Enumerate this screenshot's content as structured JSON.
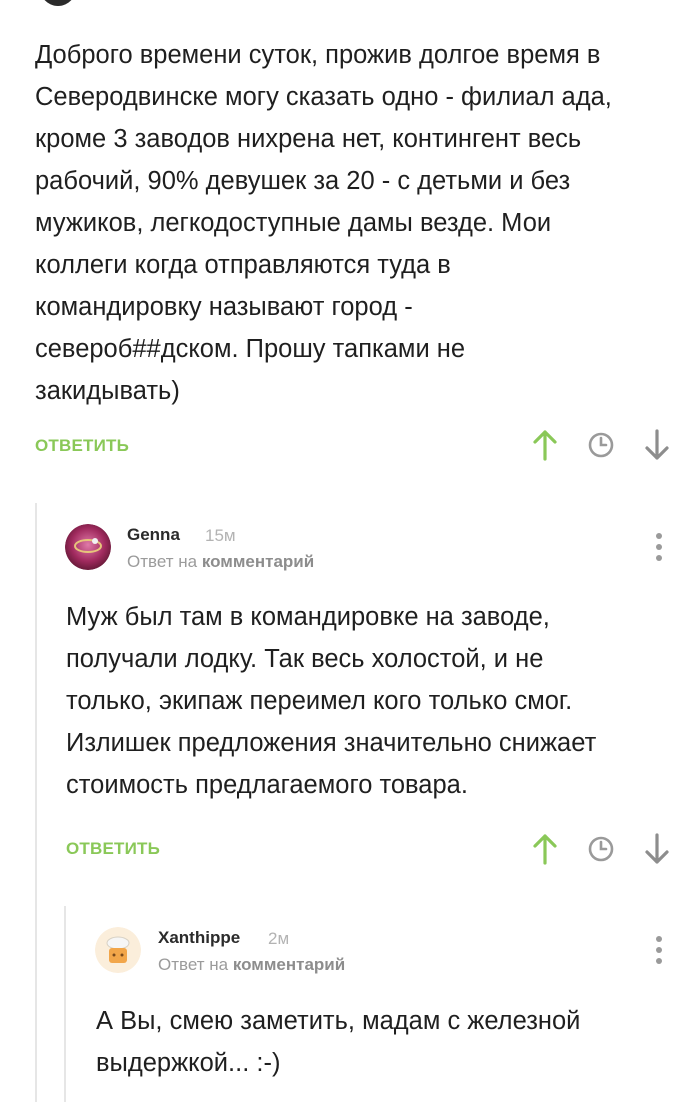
{
  "comment_root": {
    "text": "Доброго времени суток, прожив долгое время в\nСеверодвинске могу сказать одно - филиал ада,\nкроме 3 заводов нихрена нет, контингент весь\nрабочий, 90% девушек за 20 - с детьми и без\nмужиков, легкодоступные дамы везде. Мои\nколлеги когда  отправляются туда в\nкомандировку называют город -\nсевероб##дском. Прошу тапками не\nзакидывать)",
    "reply_label": "ОТВЕТИТЬ"
  },
  "comment_genna": {
    "author": "Genna",
    "time": "15м",
    "reply_prefix": "Ответ на",
    "reply_target": "комментарий",
    "text": "Муж был там в командировке на заводе,\nполучали лодку. Так весь холостой, и не\nтолько, экипаж переимел кого только смог.\nИзлишек предложения значительно снижает\nстоимость предлагаемого товара.",
    "reply_label": "ОТВЕТИТЬ"
  },
  "comment_xanthippe": {
    "author": "Xanthippe",
    "time": "2м",
    "reply_prefix": "Ответ на",
    "reply_target": "комментарий",
    "text": "А Вы, смею заметить, мадам с железной\nвыдержкой... :-)"
  },
  "colors": {
    "accent_green": "#8ac858",
    "icon_gray": "#9a9a9a",
    "thread_line": "#e6e6e6"
  },
  "icons": [
    "arrow-up-icon",
    "clock-icon",
    "arrow-down-icon",
    "more-vertical-icon"
  ]
}
